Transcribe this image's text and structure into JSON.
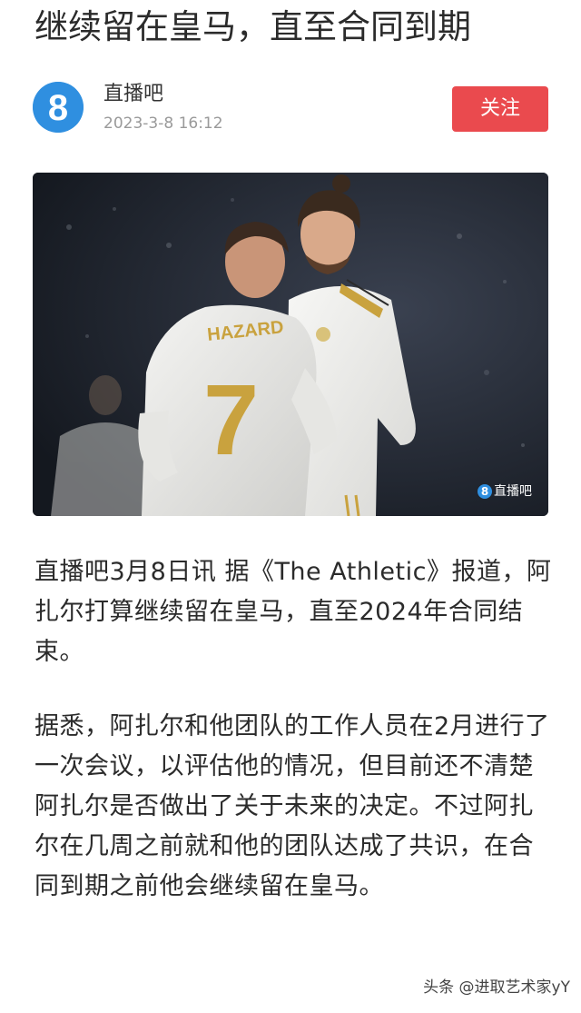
{
  "article": {
    "title": "继续留在皇马，直至合同到期",
    "paragraphs": [
      "直播吧3月8日讯 据《The Athletic》报道，阿扎尔打算继续留在皇马，直至2024年合同结束。",
      "据悉，阿扎尔和他团队的工作人员在2月进行了一次会议，以评估他的情况，但目前还不清楚阿扎尔是否做出了关于未来的决定。不过阿扎尔在几周之前就和他的团队达成了共识，在合同到期之前他会继续留在皇马。"
    ]
  },
  "author": {
    "avatar_glyph": "8",
    "name": "直播吧",
    "time": "2023-3-8 16:12",
    "follow_label": "关注"
  },
  "hero_image": {
    "jersey_name": "HAZARD",
    "jersey_number": "7",
    "watermark_glyph": "8",
    "watermark_text": "直播吧"
  },
  "footer": {
    "watermark": "头条 @进取艺术家yY"
  },
  "colors": {
    "follow_button": "#ea4a4e",
    "avatar_blue": "#2f8fe0",
    "jersey_gold": "#c9a23e"
  },
  "icons": {
    "avatar": "zhibo8-logo-icon",
    "watermark": "zhibo8-logo-icon"
  }
}
